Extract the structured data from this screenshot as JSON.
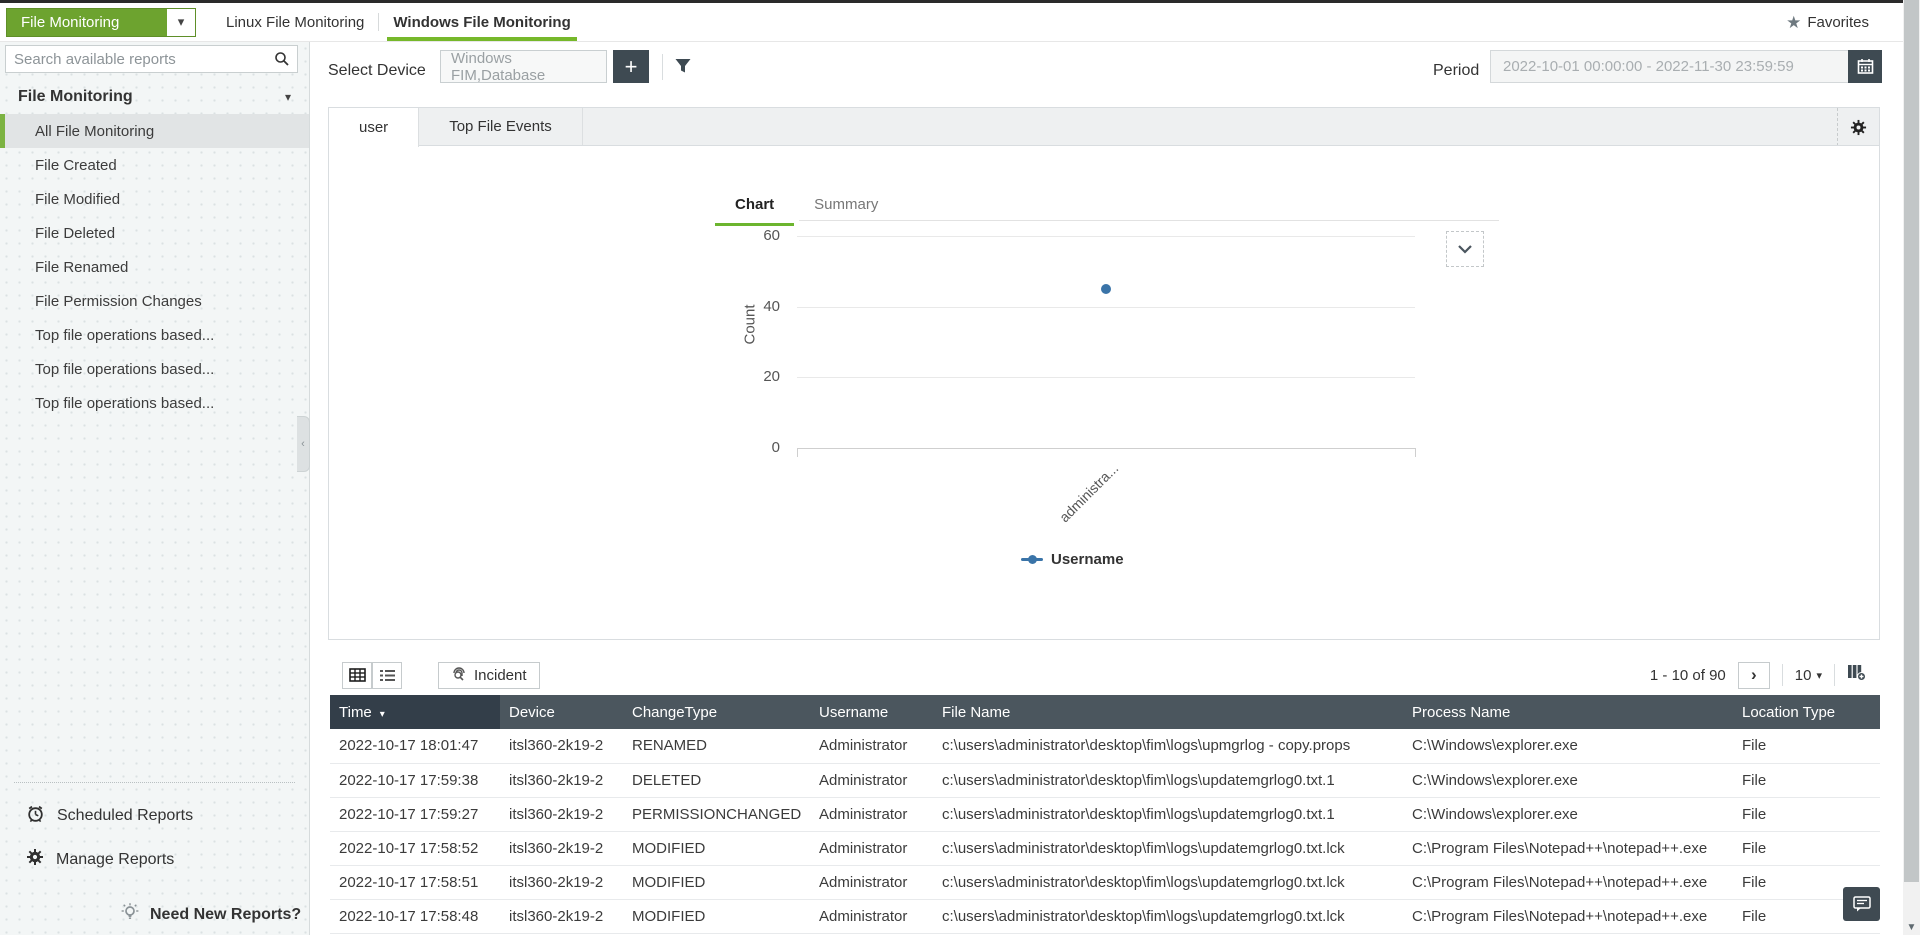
{
  "colors": {
    "accent_green": "#6da32f",
    "underline_green": "#76b82a",
    "table_header": "#4b565e",
    "point_blue": "#3a74a8"
  },
  "topbar": {
    "report_group": "File Monitoring",
    "tabs": [
      {
        "label": "Linux File Monitoring",
        "active": false
      },
      {
        "label": "Windows File Monitoring",
        "active": true
      }
    ],
    "favorites_label": "Favorites"
  },
  "sidebar": {
    "search_placeholder": "Search available reports",
    "section_label": "File Monitoring",
    "items": [
      {
        "label": "All File Monitoring",
        "selected": true
      },
      {
        "label": "File Created",
        "selected": false
      },
      {
        "label": "File Modified",
        "selected": false
      },
      {
        "label": "File Deleted",
        "selected": false
      },
      {
        "label": "File Renamed",
        "selected": false
      },
      {
        "label": "File Permission Changes",
        "selected": false
      },
      {
        "label": "Top file operations based...",
        "selected": false
      },
      {
        "label": "Top file operations based...",
        "selected": false
      },
      {
        "label": "Top file operations based...",
        "selected": false
      }
    ],
    "scheduled_reports_label": "Scheduled Reports",
    "manage_reports_label": "Manage Reports",
    "need_new_reports_label": "Need New Reports?"
  },
  "filters": {
    "select_device_label": "Select Device",
    "device_value": "Windows FIM,Database",
    "add_button_label": "+",
    "period_label": "Period",
    "period_value": "2022-10-01 00:00:00 - 2022-11-30 23:59:59"
  },
  "report_tabs": [
    {
      "label": "user",
      "active": true
    },
    {
      "label": "Top File Events",
      "active": false
    }
  ],
  "chart_panel_tabs": [
    {
      "label": "Chart",
      "active": true
    },
    {
      "label": "Summary",
      "active": false
    }
  ],
  "chart_data": {
    "type": "scatter",
    "title": "",
    "xlabel": "",
    "ylabel": "Count",
    "x": [
      "administra..."
    ],
    "series": [
      {
        "name": "Username",
        "values": [
          45
        ]
      }
    ],
    "yticks": [
      0,
      20,
      40,
      60
    ],
    "ylim": [
      0,
      60
    ],
    "grid": true,
    "legend_position": "bottom"
  },
  "table_toolbar": {
    "incident_label": "Incident",
    "pagination_range": "1 - 10 of 90",
    "page_size": "10"
  },
  "table": {
    "columns": [
      "Time",
      "Device",
      "ChangeType",
      "Username",
      "File Name",
      "Process Name",
      "Location Type"
    ],
    "sorted_column": "Time",
    "rows": [
      [
        "2022-10-17 18:01:47",
        "itsl360-2k19-2",
        "RENAMED",
        "Administrator",
        "c:\\users\\administrator\\desktop\\fim\\logs\\upmgrlog - copy.props",
        "C:\\Windows\\explorer.exe",
        "File"
      ],
      [
        "2022-10-17 17:59:38",
        "itsl360-2k19-2",
        "DELETED",
        "Administrator",
        "c:\\users\\administrator\\desktop\\fim\\logs\\updatemgrlog0.txt.1",
        "C:\\Windows\\explorer.exe",
        "File"
      ],
      [
        "2022-10-17 17:59:27",
        "itsl360-2k19-2",
        "PERMISSIONCHANGED",
        "Administrator",
        "c:\\users\\administrator\\desktop\\fim\\logs\\updatemgrlog0.txt.1",
        "C:\\Windows\\explorer.exe",
        "File"
      ],
      [
        "2022-10-17 17:58:52",
        "itsl360-2k19-2",
        "MODIFIED",
        "Administrator",
        "c:\\users\\administrator\\desktop\\fim\\logs\\updatemgrlog0.txt.lck",
        "C:\\Program Files\\Notepad++\\notepad++.exe",
        "File"
      ],
      [
        "2022-10-17 17:58:51",
        "itsl360-2k19-2",
        "MODIFIED",
        "Administrator",
        "c:\\users\\administrator\\desktop\\fim\\logs\\updatemgrlog0.txt.lck",
        "C:\\Program Files\\Notepad++\\notepad++.exe",
        "File"
      ],
      [
        "2022-10-17 17:58:48",
        "itsl360-2k19-2",
        "MODIFIED",
        "Administrator",
        "c:\\users\\administrator\\desktop\\fim\\logs\\updatemgrlog0.txt.lck",
        "C:\\Program Files\\Notepad++\\notepad++.exe",
        "File"
      ]
    ]
  }
}
